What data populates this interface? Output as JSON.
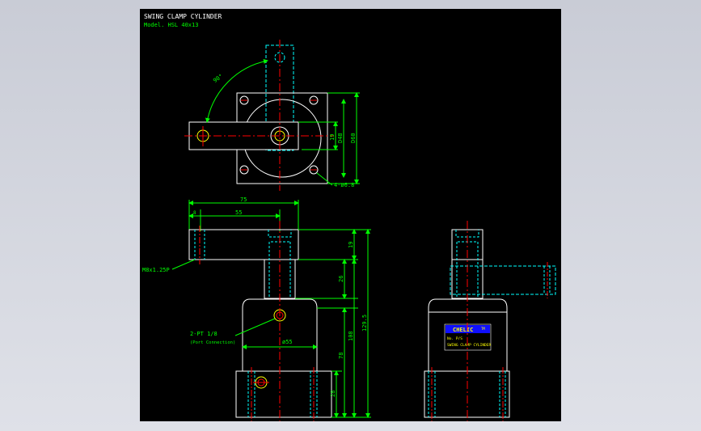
{
  "title_block": {
    "title": "SWING CLAMP CYLINDER",
    "model": "Model. HSL 40x13"
  },
  "dimensions": {
    "angle": "90°",
    "d48": "D48",
    "d60": "D60",
    "h19_top": "19",
    "holes": "4-ø6.8",
    "w75": "75",
    "w8": "8",
    "w55": "55",
    "thread": "M8x1.25P",
    "h19": "19",
    "h26": "26",
    "h129": "129.5",
    "h108": "108",
    "h78": "78",
    "h28": "28",
    "port": "2-PT 1/8",
    "port_note": "(Port Connection)",
    "dia55": "ø55"
  },
  "label_plate": {
    "brand": "CHELIC",
    "brand_sub": "TM",
    "model": "No. P/S",
    "name": "SWING CLAMP CYLINDER"
  },
  "colors": {
    "background": "#000000",
    "outline": "#ffffff",
    "dimension": "#00ff00",
    "center": "#ff0000",
    "hidden": "#00ffff",
    "port": "#ffff00",
    "plate": "#0000ff"
  }
}
